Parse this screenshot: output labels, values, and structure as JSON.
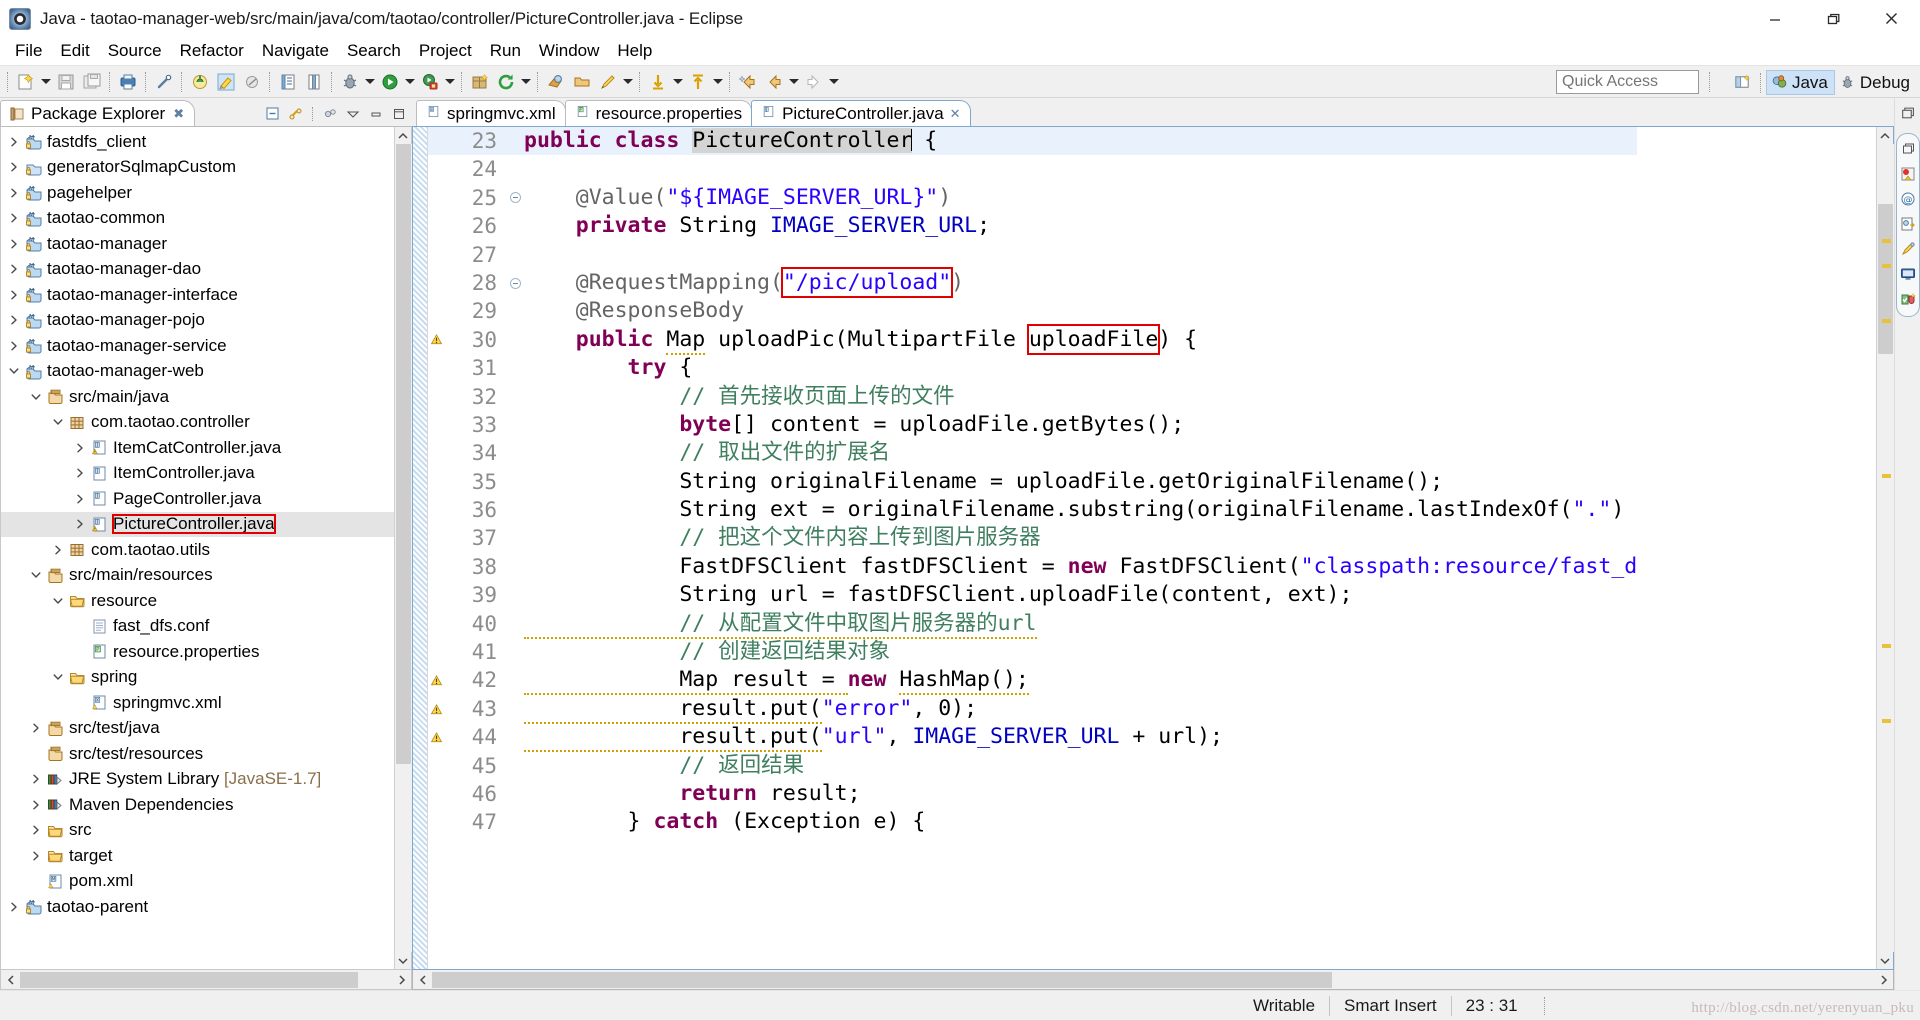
{
  "window": {
    "title": "Java - taotao-manager-web/src/main/java/com/taotao/controller/PictureController.java - Eclipse",
    "app_icon": "eclipse-icon",
    "minimize_label": "Minimize",
    "restore_label": "Restore",
    "close_label": "Close"
  },
  "menu": {
    "items": [
      "File",
      "Edit",
      "Source",
      "Refactor",
      "Navigate",
      "Search",
      "Project",
      "Run",
      "Window",
      "Help"
    ]
  },
  "toolbar": {
    "quick_access_placeholder": "Quick Access",
    "quick_access_value": "",
    "groups": [
      {
        "buttons": [
          {
            "name": "new-wizard-icon",
            "label": "New",
            "has_arrow": true
          },
          {
            "name": "save-icon",
            "label": "Save",
            "has_arrow": false
          },
          {
            "name": "save-all-icon",
            "label": "Save All",
            "has_arrow": false
          }
        ]
      },
      {
        "buttons": [
          {
            "name": "print-icon",
            "label": "Print",
            "has_arrow": false
          }
        ]
      },
      {
        "buttons": [
          {
            "name": "link-icon",
            "label": "Link",
            "has_arrow": false
          }
        ]
      },
      {
        "buttons": [
          {
            "name": "tomcat-icon",
            "label": "Tomcat",
            "has_arrow": false
          },
          {
            "name": "highlighter-icon",
            "label": "Mark Occurrences",
            "has_arrow": false
          },
          {
            "name": "skip-icon",
            "label": "Skip All Breakpoints",
            "has_arrow": false
          }
        ]
      },
      {
        "buttons": [
          {
            "name": "open-type-icon",
            "label": "Open Type",
            "has_arrow": false
          },
          {
            "name": "open-task-icon",
            "label": "Open Task",
            "has_arrow": false
          }
        ]
      },
      {
        "buttons": [
          {
            "name": "debug-icon",
            "label": "Debug",
            "has_arrow": true
          },
          {
            "name": "run-icon",
            "label": "Run",
            "has_arrow": true
          },
          {
            "name": "external-tools-icon",
            "label": "External Tools",
            "has_arrow": true
          }
        ]
      },
      {
        "buttons": [
          {
            "name": "new-java-package-icon",
            "label": "New Java Package",
            "has_arrow": false
          },
          {
            "name": "refresh-icon",
            "label": "Refresh",
            "has_arrow": true
          }
        ]
      },
      {
        "buttons": [
          {
            "name": "search-icon",
            "label": "Search",
            "has_arrow": false
          },
          {
            "name": "open-resource-icon",
            "label": "Open Resource",
            "has_arrow": false
          },
          {
            "name": "pencil-icon",
            "label": "Annotation",
            "has_arrow": true
          }
        ]
      },
      {
        "buttons": [
          {
            "name": "next-annotation-icon",
            "label": "Next Annotation",
            "has_arrow": true
          },
          {
            "name": "previous-annotation-icon",
            "label": "Previous Annotation",
            "has_arrow": true
          }
        ]
      },
      {
        "buttons": [
          {
            "name": "back-icon",
            "label": "Back",
            "has_arrow": true
          },
          {
            "name": "forward-icon",
            "label": "Forward",
            "has_arrow": true
          }
        ]
      }
    ],
    "perspectives": {
      "open_perspective_label": "Open Perspective",
      "items": [
        {
          "name": "perspective-java",
          "label": "Java",
          "active": true
        },
        {
          "name": "perspective-debug",
          "label": "Debug",
          "active": false
        }
      ]
    }
  },
  "package_explorer": {
    "tab_label": "Package Explorer",
    "view_buttons": [
      "collapse-all-icon",
      "link-with-editor-icon",
      "view-menu-icon",
      "minimize-icon",
      "maximize-icon"
    ],
    "tree": [
      {
        "indent": 0,
        "twisty": "collapsed",
        "icon": "maven-project-icon",
        "label": "fastdfs_client"
      },
      {
        "indent": 0,
        "twisty": "collapsed",
        "icon": "project-icon",
        "label": "generatorSqlmapCustom"
      },
      {
        "indent": 0,
        "twisty": "collapsed",
        "icon": "maven-project-icon",
        "label": "pagehelper"
      },
      {
        "indent": 0,
        "twisty": "collapsed",
        "icon": "maven-project-icon",
        "label": "taotao-common"
      },
      {
        "indent": 0,
        "twisty": "collapsed",
        "icon": "maven-project-icon",
        "label": "taotao-manager"
      },
      {
        "indent": 0,
        "twisty": "collapsed",
        "icon": "maven-project-icon",
        "label": "taotao-manager-dao"
      },
      {
        "indent": 0,
        "twisty": "collapsed",
        "icon": "maven-project-icon",
        "label": "taotao-manager-interface"
      },
      {
        "indent": 0,
        "twisty": "collapsed",
        "icon": "maven-project-icon",
        "label": "taotao-manager-pojo"
      },
      {
        "indent": 0,
        "twisty": "collapsed",
        "icon": "maven-project-icon",
        "label": "taotao-manager-service"
      },
      {
        "indent": 0,
        "twisty": "expanded",
        "icon": "maven-project-icon",
        "label": "taotao-manager-web"
      },
      {
        "indent": 1,
        "twisty": "expanded",
        "icon": "source-folder-icon",
        "label": "src/main/java"
      },
      {
        "indent": 2,
        "twisty": "expanded",
        "icon": "package-icon",
        "label": "com.taotao.controller"
      },
      {
        "indent": 3,
        "twisty": "collapsed",
        "icon": "java-file-warn-icon",
        "label": "ItemCatController.java"
      },
      {
        "indent": 3,
        "twisty": "collapsed",
        "icon": "java-file-icon",
        "label": "ItemController.java"
      },
      {
        "indent": 3,
        "twisty": "collapsed",
        "icon": "java-file-icon",
        "label": "PageController.java"
      },
      {
        "indent": 3,
        "twisty": "collapsed",
        "icon": "java-file-warn-icon",
        "label": "PictureController.java",
        "selected": true,
        "boxed": true
      },
      {
        "indent": 2,
        "twisty": "collapsed",
        "icon": "package-icon",
        "label": "com.taotao.utils"
      },
      {
        "indent": 1,
        "twisty": "expanded",
        "icon": "source-folder-icon",
        "label": "src/main/resources"
      },
      {
        "indent": 2,
        "twisty": "expanded",
        "icon": "folder-icon",
        "label": "resource"
      },
      {
        "indent": 3,
        "twisty": "none",
        "icon": "conf-file-icon",
        "label": "fast_dfs.conf"
      },
      {
        "indent": 3,
        "twisty": "none",
        "icon": "properties-file-icon",
        "label": "resource.properties"
      },
      {
        "indent": 2,
        "twisty": "expanded",
        "icon": "folder-icon",
        "label": "spring"
      },
      {
        "indent": 3,
        "twisty": "none",
        "icon": "xml-file-icon",
        "label": "springmvc.xml"
      },
      {
        "indent": 1,
        "twisty": "collapsed",
        "icon": "source-folder-icon",
        "label": "src/test/java"
      },
      {
        "indent": 1,
        "twisty": "none",
        "icon": "source-folder-icon",
        "label": "src/test/resources"
      },
      {
        "indent": 1,
        "twisty": "collapsed",
        "icon": "library-icon",
        "label": "JRE System Library ",
        "suffix": "[JavaSE-1.7]"
      },
      {
        "indent": 1,
        "twisty": "collapsed",
        "icon": "library-icon",
        "label": "Maven Dependencies"
      },
      {
        "indent": 1,
        "twisty": "collapsed",
        "icon": "folder-icon",
        "label": "src"
      },
      {
        "indent": 1,
        "twisty": "collapsed",
        "icon": "folder-icon",
        "label": "target"
      },
      {
        "indent": 1,
        "twisty": "none",
        "icon": "pom-file-icon",
        "label": "pom.xml"
      },
      {
        "indent": 0,
        "twisty": "collapsed",
        "icon": "maven-project-icon",
        "label": "taotao-parent"
      }
    ]
  },
  "editor": {
    "tabs": [
      {
        "icon": "xml-file-icon",
        "label": "springmvc.xml",
        "active": false,
        "closable": false
      },
      {
        "icon": "properties-file-icon",
        "label": "resource.properties",
        "active": false,
        "closable": false
      },
      {
        "icon": "java-file-icon",
        "label": "PictureController.java",
        "active": true,
        "closable": true
      }
    ],
    "close_symbol": "✕",
    "first_line_number": 23,
    "lines": [
      {
        "n": 23,
        "current": true,
        "fold": false,
        "warn": false,
        "tokens": [
          {
            "t": "public ",
            "c": "kw"
          },
          {
            "t": "class ",
            "c": "kw"
          },
          {
            "t": "PictureController",
            "c": "sel"
          },
          {
            "t": "CARET",
            "c": "caret"
          },
          {
            "t": " {",
            "c": "plain"
          }
        ]
      },
      {
        "n": 24,
        "tokens": []
      },
      {
        "n": 25,
        "fold": true,
        "tokens": [
          {
            "t": "    @Value(",
            "c": "ann"
          },
          {
            "t": "\"${IMAGE_SERVER_URL}\"",
            "c": "str"
          },
          {
            "t": ")",
            "c": "ann"
          }
        ]
      },
      {
        "n": 26,
        "tokens": [
          {
            "t": "    private ",
            "c": "kw"
          },
          {
            "t": "String ",
            "c": "plain"
          },
          {
            "t": "IMAGE_SERVER_URL",
            "c": "fld"
          },
          {
            "t": ";",
            "c": "plain"
          }
        ]
      },
      {
        "n": 27,
        "tokens": []
      },
      {
        "n": 28,
        "fold": true,
        "tokens": [
          {
            "t": "    @RequestMapping(",
            "c": "ann"
          },
          {
            "t": "\"/pic/upload\"",
            "c": "str",
            "box": true
          },
          {
            "t": ")",
            "c": "ann"
          }
        ]
      },
      {
        "n": 29,
        "tokens": [
          {
            "t": "    @ResponseBody",
            "c": "ann"
          }
        ]
      },
      {
        "n": 30,
        "warn": true,
        "tokens": [
          {
            "t": "    public ",
            "c": "kw"
          },
          {
            "t": "Map",
            "c": "plain",
            "squiggle": true
          },
          {
            "t": " uploadPic(MultipartFile ",
            "c": "plain"
          },
          {
            "t": "uploadFile",
            "c": "plain",
            "box": true
          },
          {
            "t": ") {",
            "c": "plain"
          }
        ]
      },
      {
        "n": 31,
        "tokens": [
          {
            "t": "        try",
            "c": "kw"
          },
          {
            "t": " {",
            "c": "plain"
          }
        ]
      },
      {
        "n": 32,
        "tokens": [
          {
            "t": "            // 首先接收页面上传的文件",
            "c": "cmt"
          }
        ]
      },
      {
        "n": 33,
        "tokens": [
          {
            "t": "            byte",
            "c": "kw"
          },
          {
            "t": "[] content = ",
            "c": "plain"
          },
          {
            "t": "uploadFile",
            "c": "plain"
          },
          {
            "t": ".getBytes();",
            "c": "plain"
          }
        ]
      },
      {
        "n": 34,
        "tokens": [
          {
            "t": "            // 取出文件的扩展名",
            "c": "cmt"
          }
        ]
      },
      {
        "n": 35,
        "tokens": [
          {
            "t": "            String originalFilename = uploadFile.getOriginalFilename();",
            "c": "plain"
          }
        ]
      },
      {
        "n": 36,
        "tokens": [
          {
            "t": "            String ext = originalFilename.substring(originalFilename.lastIndexOf(",
            "c": "plain"
          },
          {
            "t": "\".\"",
            "c": "str"
          },
          {
            "t": ")",
            "c": "plain"
          }
        ]
      },
      {
        "n": 37,
        "tokens": [
          {
            "t": "            // 把这个文件内容上传到图片服务器",
            "c": "cmt"
          }
        ]
      },
      {
        "n": 38,
        "tokens": [
          {
            "t": "            FastDFSClient fastDFSClient = ",
            "c": "plain"
          },
          {
            "t": "new ",
            "c": "kw"
          },
          {
            "t": "FastDFSClient(",
            "c": "plain"
          },
          {
            "t": "\"classpath:resource/fast_d",
            "c": "str"
          }
        ]
      },
      {
        "n": 39,
        "tokens": [
          {
            "t": "            String url = fastDFSClient.uploadFile(content, ext);",
            "c": "plain"
          }
        ]
      },
      {
        "n": 40,
        "tokens": [
          {
            "t": "            // 从配置文件中取图片服务器的url",
            "c": "cmt",
            "squiggle": true
          }
        ]
      },
      {
        "n": 41,
        "tokens": [
          {
            "t": "            // 创建返回结果对象",
            "c": "cmt"
          }
        ]
      },
      {
        "n": 42,
        "warn": true,
        "tokens": [
          {
            "t": "            Map result = ",
            "c": "plain",
            "squiggle": true
          },
          {
            "t": "new ",
            "c": "kw"
          },
          {
            "t": "HashMap();",
            "c": "plain",
            "squiggle": true
          }
        ]
      },
      {
        "n": 43,
        "warn": true,
        "tokens": [
          {
            "t": "            result.put(",
            "c": "plain",
            "squiggle": true
          },
          {
            "t": "\"error\"",
            "c": "str"
          },
          {
            "t": ", ",
            "c": "plain"
          },
          {
            "t": "0",
            "c": "plain"
          },
          {
            "t": ");",
            "c": "plain"
          }
        ]
      },
      {
        "n": 44,
        "warn": true,
        "tokens": [
          {
            "t": "            result.put(",
            "c": "plain",
            "squiggle": true
          },
          {
            "t": "\"url\"",
            "c": "str"
          },
          {
            "t": ", ",
            "c": "plain"
          },
          {
            "t": "IMAGE_SERVER_URL",
            "c": "fld"
          },
          {
            "t": " + url);",
            "c": "plain"
          }
        ]
      },
      {
        "n": 45,
        "tokens": [
          {
            "t": "            // 返回结果",
            "c": "cmt"
          }
        ]
      },
      {
        "n": 46,
        "tokens": [
          {
            "t": "            return",
            "c": "kw"
          },
          {
            "t": " result;",
            "c": "plain"
          }
        ]
      },
      {
        "n": 47,
        "clipped": true,
        "tokens": [
          {
            "t": "        } ",
            "c": "plain"
          },
          {
            "t": "catch ",
            "c": "kw"
          },
          {
            "t": "(Exception e) {",
            "c": "plain"
          }
        ]
      }
    ]
  },
  "right_rail": {
    "top_icon": "restore-view-icon",
    "icons": [
      "restore-view-icon",
      "problems-view-icon",
      "at-view-icon",
      "outline-view-icon",
      "javadoc-view-icon",
      "console-view-icon",
      "junit-view-icon"
    ]
  },
  "status_bar": {
    "writable": "Writable",
    "insert_mode": "Smart Insert",
    "cursor_position": "23 : 31",
    "watermark": "http://blog.csdn.net/yerenyuan_pku"
  },
  "colors": {
    "keyword": "#7f0055",
    "string": "#2a00ff",
    "comment": "#3f7f5f",
    "annotation": "#646464",
    "field": "#0000c0",
    "accent": "#cde2f6",
    "highlight_box": "#e00000",
    "current_line": "#e8f1fc"
  }
}
